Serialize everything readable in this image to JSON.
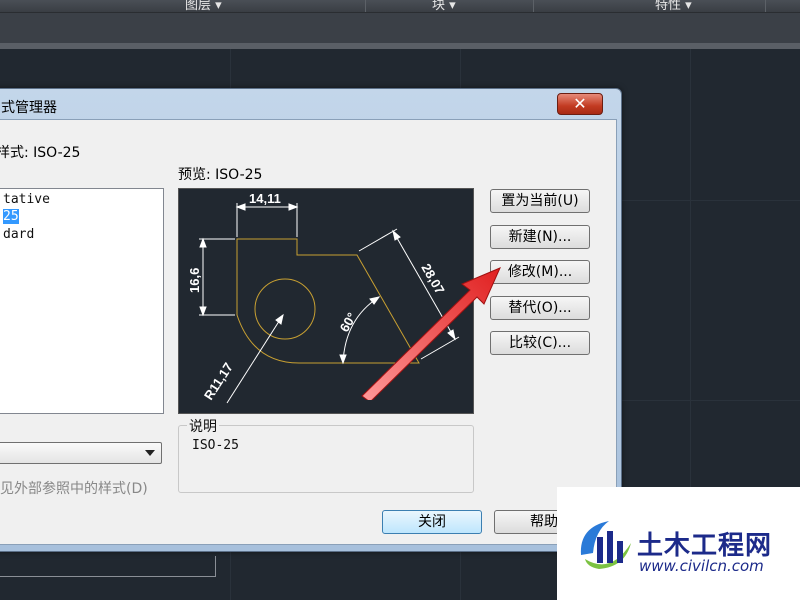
{
  "ribbon": {
    "sections": [
      "图层 ▾",
      "块 ▾",
      "特性 ▾"
    ]
  },
  "dialog": {
    "title": "式管理器",
    "current_style_label": "样式: ISO-25",
    "preview_label": "预览: ISO-25",
    "styles_list": [
      "tative",
      "25",
      "dard"
    ],
    "selected_index": 1,
    "filter_value": "",
    "checkbox_label": "见外部参照中的样式(D)",
    "description_legend": "说明",
    "description_text": "ISO-25",
    "buttons": {
      "set_current": "置为当前(U)",
      "new": "新建(N)...",
      "modify": "修改(M)...",
      "override": "替代(O)...",
      "compare": "比较(C)...",
      "close": "关闭",
      "help": "帮助"
    },
    "preview_dims": {
      "width": "14,11",
      "height": "16,6",
      "slant": "28,07",
      "angle": "60°",
      "radius": "R11,17"
    }
  },
  "watermark": {
    "brand": "土木工程网",
    "url": "www.civilcn.com"
  },
  "colors": {
    "workspace_bg": "#212830",
    "preview_geometry": "#c8a032",
    "annotation_arrow": "#e02020"
  }
}
